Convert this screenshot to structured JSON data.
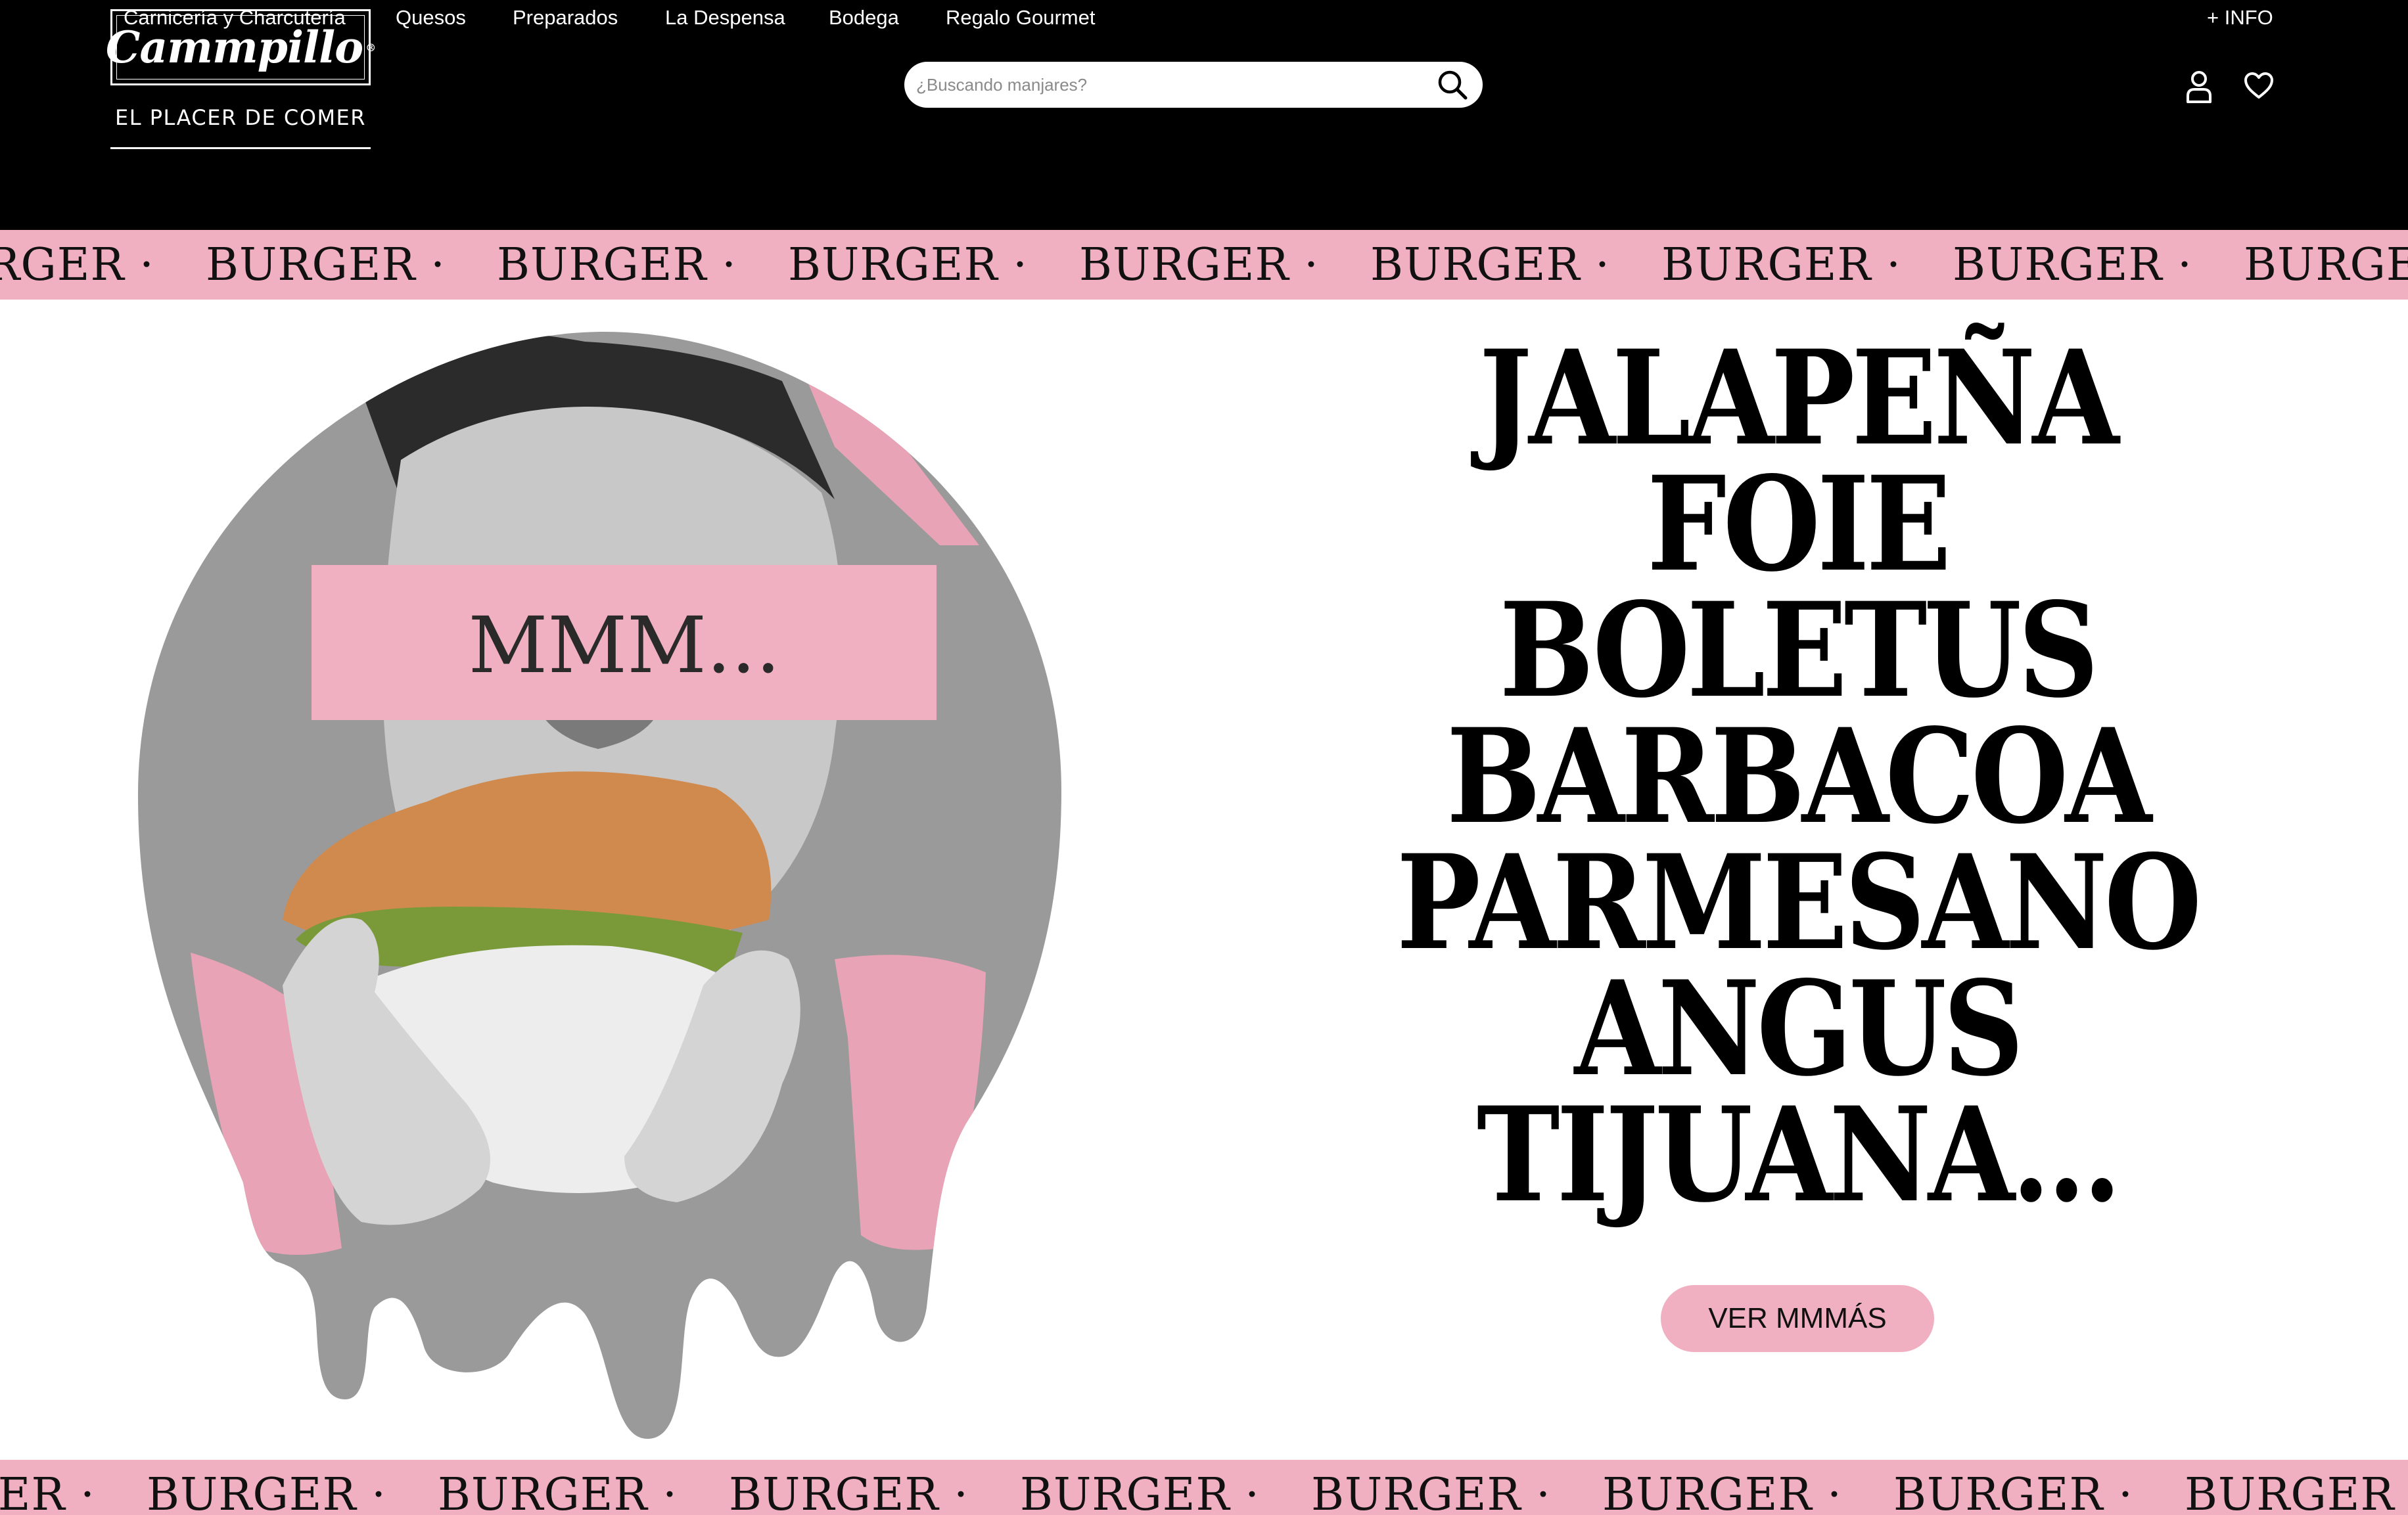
{
  "brand": {
    "name": "Cammpillo",
    "registered_mark": "®",
    "tagline": "EL PLACER DE COMER"
  },
  "search": {
    "placeholder": "¿Buscando manjares?",
    "value": ""
  },
  "header_icons": {
    "search": "magnifier-icon",
    "account": "user-icon",
    "wishlist": "heart-icon"
  },
  "nav": {
    "items": [
      {
        "label": "Carnicería y Charcutería"
      },
      {
        "label": "Quesos"
      },
      {
        "label": "Preparados"
      },
      {
        "label": "La Despensa"
      },
      {
        "label": "Bodega"
      },
      {
        "label": "Regalo Gourmet"
      }
    ],
    "info": "+ INFO"
  },
  "ticker": {
    "word": "BURGER",
    "separator": "·"
  },
  "hero": {
    "overlay_text": "MMM...",
    "headline_lines": [
      "JALAPEÑA",
      "FOIE",
      "BOLETUS",
      "BARBACOA",
      "PARMESANO",
      "ANGUS",
      "TIJUANA..."
    ],
    "cta_label": "VER MMMÁS"
  },
  "colors": {
    "header_bg": "#000000",
    "accent_pink": "#f1b0c1",
    "text_dark": "#111111",
    "page_bg": "#ffffff"
  }
}
